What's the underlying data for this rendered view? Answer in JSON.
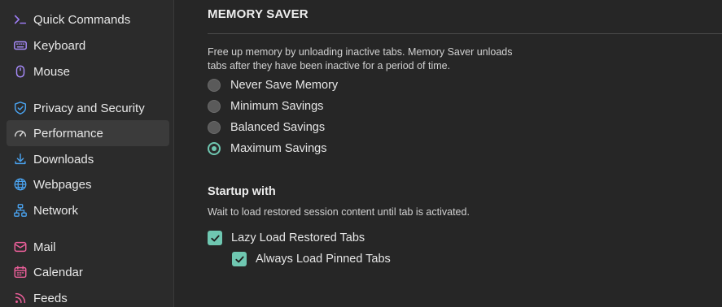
{
  "colors": {
    "accent": "#6fc7b1",
    "sidebar_bg": "#2b2b2b",
    "main_bg": "#262626",
    "active_item_bg": "#3b3b3b"
  },
  "sidebar": {
    "items": [
      {
        "label": "Quick Commands",
        "icon": "quick-commands-icon",
        "active": false
      },
      {
        "label": "Keyboard",
        "icon": "keyboard-icon",
        "active": false
      },
      {
        "label": "Mouse",
        "icon": "mouse-icon",
        "active": false
      },
      {
        "label": "Privacy and Security",
        "icon": "shield-icon",
        "active": false
      },
      {
        "label": "Performance",
        "icon": "speedometer-icon",
        "active": true
      },
      {
        "label": "Downloads",
        "icon": "download-icon",
        "active": false
      },
      {
        "label": "Webpages",
        "icon": "globe-icon",
        "active": false
      },
      {
        "label": "Network",
        "icon": "network-icon",
        "active": false
      },
      {
        "label": "Mail",
        "icon": "mail-icon",
        "active": false
      },
      {
        "label": "Calendar",
        "icon": "calendar-icon",
        "active": false
      },
      {
        "label": "Feeds",
        "icon": "feeds-icon",
        "active": false
      }
    ]
  },
  "memory_saver": {
    "title": "MEMORY SAVER",
    "description": "Free up memory by unloading inactive tabs. Memory Saver unloads tabs after they have been inactive for a period of time.",
    "options": [
      {
        "label": "Never Save Memory",
        "checked": false
      },
      {
        "label": "Minimum Savings",
        "checked": false
      },
      {
        "label": "Balanced Savings",
        "checked": false
      },
      {
        "label": "Maximum Savings",
        "checked": true
      }
    ]
  },
  "startup": {
    "title": "Startup with",
    "description": "Wait to load restored session content until tab is activated.",
    "lazy_load_label": "Lazy Load Restored Tabs",
    "lazy_load_checked": true,
    "pinned_label": "Always Load Pinned Tabs",
    "pinned_checked": true
  }
}
